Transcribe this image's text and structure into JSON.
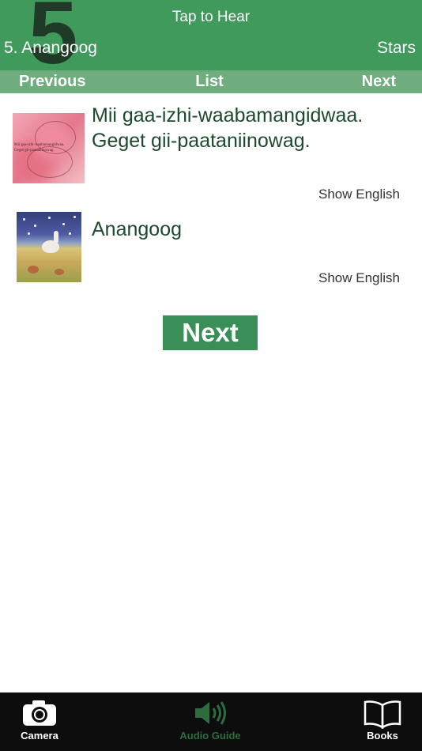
{
  "header": {
    "big_number": "5",
    "tap_to_hear": "Tap to Hear",
    "story_title": "5. Anangoog",
    "stars_label": "Stars"
  },
  "navbar": {
    "previous_label": "Previous",
    "list_label": "List",
    "next_label": "Next"
  },
  "content": {
    "pages": [
      {
        "text_line_1": "Mii gaa-izhi-waabamangidwaa.",
        "text_line_2": "Geget gii-paataniinowag.",
        "thumbnail_caption_1": "Mii gaa-izhi-waabamangidwaa.",
        "thumbnail_caption_2": "Geget gii-paataniinowag.",
        "show_english_label": "Show English"
      },
      {
        "text_line_1": "Anangoog",
        "show_english_label": "Show English"
      }
    ],
    "next_button_label": "Next"
  },
  "tabbar": {
    "items": [
      {
        "label": "Camera",
        "icon": "camera-icon",
        "active": false
      },
      {
        "label": "Audio Guide",
        "icon": "speaker-icon",
        "active": true
      },
      {
        "label": "Books",
        "icon": "book-icon",
        "active": false
      }
    ]
  },
  "colors": {
    "header_green": "#3f9a5c",
    "navbar_green": "#6fad7e",
    "text_green": "#1e4a2c",
    "button_green": "#3a8f56",
    "tabbar_black": "#0d0d0d",
    "active_tab_green": "#2e6b3d"
  }
}
